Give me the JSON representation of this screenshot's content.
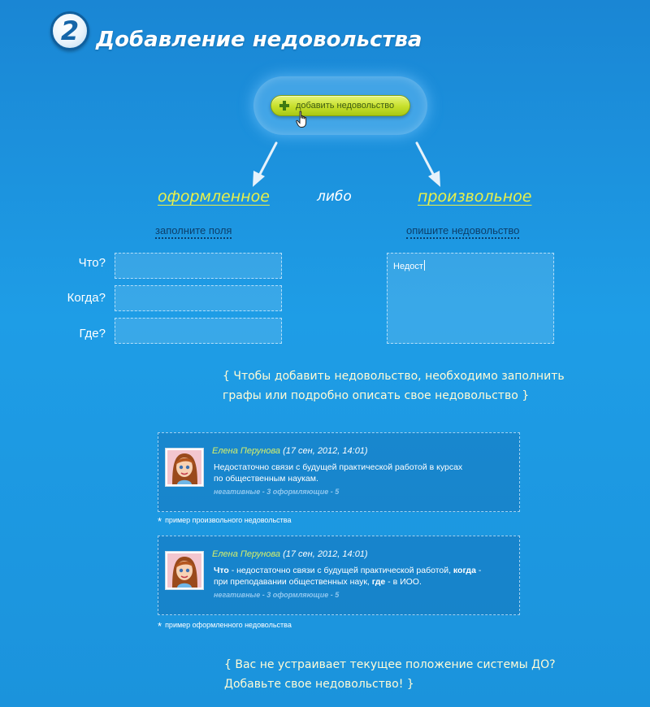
{
  "header": {
    "step_number": "2",
    "title": "Добавление недовольства"
  },
  "add_button": {
    "label": "добавить недовольство",
    "icon": "plus-icon"
  },
  "options": {
    "left": "оформленное",
    "middle": "либо",
    "right": "произвольное",
    "left_hint": "заполните поля",
    "right_hint": "опишите недовольство"
  },
  "form": {
    "what_label": "Что?",
    "when_label": "Когда?",
    "where_label": "Где?",
    "what_value": "",
    "when_value": "",
    "where_value": "",
    "description_value": "Недост"
  },
  "notes": {
    "instruction_line1": "{ Чтобы добавить недовольство, необходимо заполнить",
    "instruction_line2": "графы или подробно описать свое недовольство }",
    "footer_line1": "{ Вас не устраивает текущее положение системы ДО?",
    "footer_line2": "Добавьте свое недовольство! }"
  },
  "examples": [
    {
      "author": "Елена Перунова",
      "date": "(17 сен, 2012, 14:01)",
      "text_line1": "Недостаточно связи с будущей практической работой в курсах",
      "text_line2": "по общественным наукам.",
      "tags": "негативные - 3 оформляющие - 5",
      "caption": "пример произвольного недовольства"
    },
    {
      "author": "Елена Перунова",
      "date": "(17 сен, 2012, 14:01)",
      "what_kw": "Что",
      "what_text": " - недостаточно связи с будущей практической работой, ",
      "when_kw": "когда",
      "when_text": " -",
      "line2_a": "при преподавании общественных наук, ",
      "where_kw": "где",
      "where_text": " - в ИОО.",
      "tags": "негативные - 3 оформляющие - 5",
      "caption": "пример оформленного недовольства"
    }
  ],
  "colors": {
    "background": "#1e9de6",
    "accent_yellow": "#e8f04a",
    "button_green": "#c6df2a",
    "hint_dark": "#0c3f6b"
  }
}
